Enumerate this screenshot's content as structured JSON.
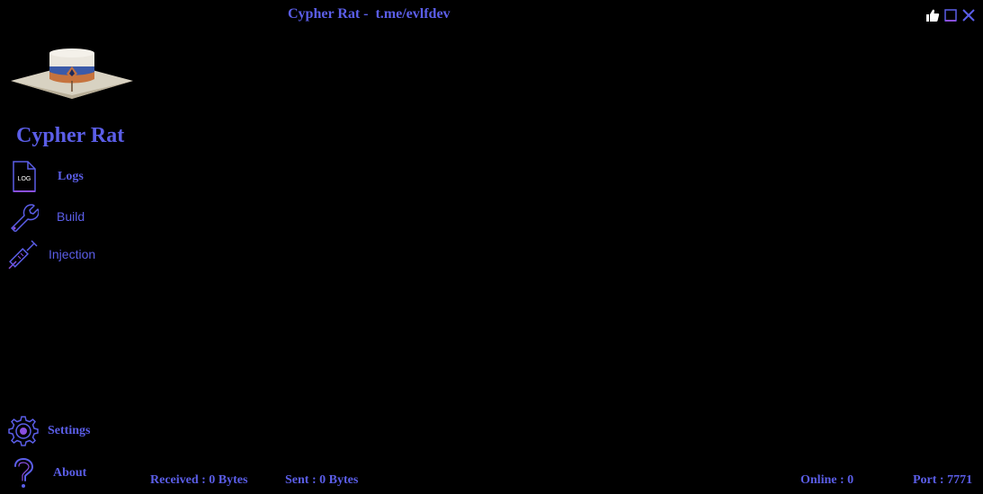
{
  "window": {
    "title": "Cypher Rat -  t.me/evlfdev",
    "controls": [
      {
        "icon": "thumbs-up-icon"
      },
      {
        "icon": "minimize-icon"
      },
      {
        "icon": "close-icon"
      }
    ]
  },
  "sidebar": {
    "app_name": "Cypher Rat",
    "logo_icon": "hat-logo",
    "items": [
      {
        "label": "Logs",
        "icon": "log-file-icon",
        "log_text": "LOG"
      },
      {
        "label": "Build",
        "icon": "wrench-icon"
      },
      {
        "label": "Injection",
        "icon": "syringe-icon"
      },
      {
        "label": "Settings",
        "icon": "gear-icon"
      },
      {
        "label": "About",
        "icon": "question-icon"
      }
    ]
  },
  "status_bar": {
    "received": "Received : 0 Bytes",
    "sent": "Sent : 0 Bytes",
    "online": "Online : 0",
    "port": "Port : 7771"
  },
  "colors": {
    "accent": "#5b5ee8",
    "icon_purple": "#8a4fe0",
    "background": "#000000"
  }
}
